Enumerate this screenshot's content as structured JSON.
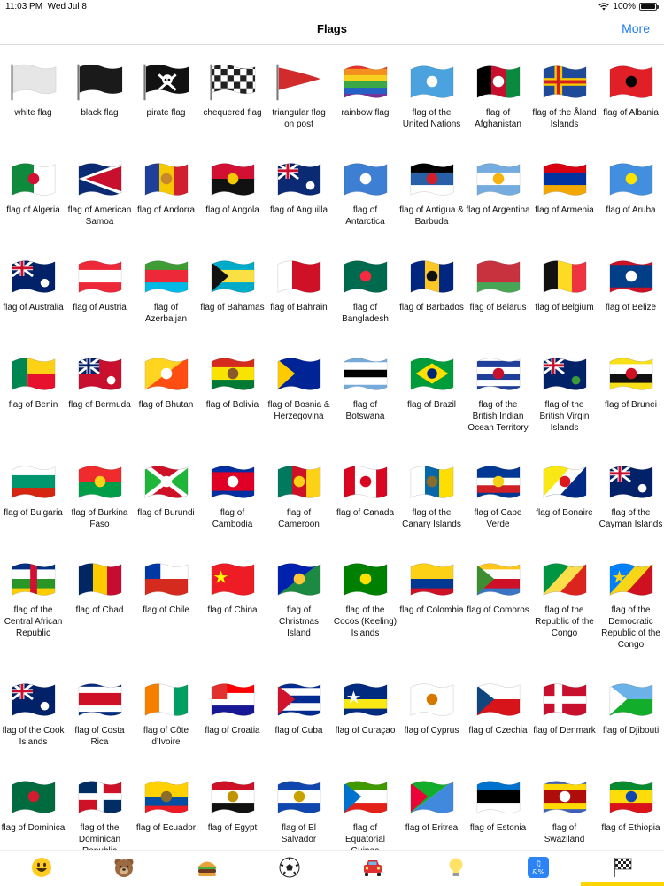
{
  "status": {
    "time": "11:03 PM",
    "date": "Wed Jul 8",
    "battery": "100%",
    "battery_level": 1.0,
    "wifi_icon": "wifi-icon"
  },
  "nav": {
    "title": "Flags",
    "more": "More"
  },
  "flags": [
    {
      "label": "white flag",
      "kind": "post-flag",
      "colors": [
        "#e6e6e6"
      ]
    },
    {
      "label": "black flag",
      "kind": "post-flag",
      "colors": [
        "#1a1a1a"
      ]
    },
    {
      "label": "pirate flag",
      "kind": "post-flag",
      "colors": [
        "#111111"
      ],
      "emblem": "skull"
    },
    {
      "label": "chequered flag",
      "kind": "post-flag",
      "colors": [
        "#222222"
      ],
      "emblem": "checker"
    },
    {
      "label": "triangular flag on post",
      "kind": "triangle",
      "colors": [
        "#d22b2b"
      ]
    },
    {
      "label": "rainbow flag",
      "kind": "h",
      "colors": [
        "#e8322c",
        "#f39020",
        "#f6d21f",
        "#3aa846",
        "#2460c6",
        "#7d2f90"
      ]
    },
    {
      "label": "flag of the United Nations",
      "kind": "solid",
      "colors": [
        "#4aa3df"
      ],
      "emblem": "circle",
      "emblem_color": "#ffffff"
    },
    {
      "label": "flag of Afghanistan",
      "kind": "v",
      "colors": [
        "#000000",
        "#c8102e",
        "#0a8a3f"
      ],
      "emblem": "circle",
      "emblem_color": "#ffffff"
    },
    {
      "label": "flag of the Åland Islands",
      "kind": "nordic",
      "colors": [
        "#1f4a9a",
        "#f5c800",
        "#d22020"
      ]
    },
    {
      "label": "flag of Albania",
      "kind": "solid",
      "colors": [
        "#e11f26"
      ],
      "emblem": "circle",
      "emblem_color": "#000000"
    },
    {
      "label": "flag of Algeria",
      "kind": "v",
      "colors": [
        "#0f8a3c",
        "#ffffff"
      ],
      "emblem": "circle",
      "emblem_color": "#d21034"
    },
    {
      "label": "flag of American Samoa",
      "kind": "triangle-left",
      "colors": [
        "#0b2a74",
        "#ffffff",
        "#c8102e"
      ]
    },
    {
      "label": "flag of Andorra",
      "kind": "v",
      "colors": [
        "#1f3f9a",
        "#f5c800",
        "#d11f2f"
      ],
      "emblem": "circle",
      "emblem_color": "#c7892a"
    },
    {
      "label": "flag of Angola",
      "kind": "h",
      "colors": [
        "#d21034",
        "#111111"
      ],
      "emblem": "circle",
      "emblem_color": "#f5c800"
    },
    {
      "label": "flag of Anguilla",
      "kind": "canton",
      "colors": [
        "#0b2a74",
        "#c8102e"
      ],
      "emblem": "circle",
      "emblem_color": "#ffffff"
    },
    {
      "label": "flag of Antarctica",
      "kind": "solid",
      "colors": [
        "#3d7fd3"
      ],
      "emblem": "circle",
      "emblem_color": "#ffffff"
    },
    {
      "label": "flag of Antigua & Barbuda",
      "kind": "h",
      "colors": [
        "#000000",
        "#2760a6",
        "#ffffff"
      ],
      "emblem": "circle",
      "emblem_color": "#d31f2a"
    },
    {
      "label": "flag of Argentina",
      "kind": "h",
      "colors": [
        "#74acdf",
        "#ffffff",
        "#74acdf"
      ],
      "emblem": "circle",
      "emblem_color": "#f6b40e"
    },
    {
      "label": "flag of Armenia",
      "kind": "h",
      "colors": [
        "#d90012",
        "#0033a0",
        "#f2a800"
      ]
    },
    {
      "label": "flag of Aruba",
      "kind": "solid",
      "colors": [
        "#418fde"
      ],
      "emblem": "circle",
      "emblem_color": "#f9e300"
    },
    {
      "label": "flag of Australia",
      "kind": "canton",
      "colors": [
        "#012169",
        "#c8102e"
      ],
      "emblem": "circle",
      "emblem_color": "#ffffff"
    },
    {
      "label": "flag of Austria",
      "kind": "h",
      "colors": [
        "#ed2939",
        "#ffffff",
        "#ed2939"
      ]
    },
    {
      "label": "flag of Azerbaijan",
      "kind": "h",
      "colors": [
        "#3f9c35",
        "#ed2939",
        "#00b9e4"
      ]
    },
    {
      "label": "flag of Bahamas",
      "kind": "h",
      "colors": [
        "#00abc9",
        "#fae042",
        "#00abc9"
      ],
      "emblem": "triangle",
      "emblem_color": "#111111"
    },
    {
      "label": "flag of Bahrain",
      "kind": "v",
      "colors": [
        "#ffffff",
        "#ce1126",
        "#ce1126"
      ]
    },
    {
      "label": "flag of Bangladesh",
      "kind": "solid",
      "colors": [
        "#006a4e"
      ],
      "emblem": "circle",
      "emblem_color": "#f42a41"
    },
    {
      "label": "flag of Barbados",
      "kind": "v",
      "colors": [
        "#00267f",
        "#ffc726",
        "#00267f"
      ],
      "emblem": "circle",
      "emblem_color": "#111111"
    },
    {
      "label": "flag of Belarus",
      "kind": "h",
      "colors": [
        "#c8313e",
        "#c8313e",
        "#4aa657"
      ]
    },
    {
      "label": "flag of Belgium",
      "kind": "v",
      "colors": [
        "#111111",
        "#fdda24",
        "#ef3340"
      ]
    },
    {
      "label": "flag of Belize",
      "kind": "h",
      "colors": [
        "#ce1126",
        "#003f87",
        "#003f87",
        "#003f87",
        "#ce1126"
      ],
      "emblem": "circle",
      "emblem_color": "#ffffff"
    },
    {
      "label": "flag of Benin",
      "kind": "split",
      "colors": [
        "#008751",
        "#fcd116",
        "#e8112d"
      ]
    },
    {
      "label": "flag of Bermuda",
      "kind": "canton",
      "colors": [
        "#c8102e",
        "#012169"
      ],
      "emblem": "circle",
      "emblem_color": "#ffffff"
    },
    {
      "label": "flag of Bhutan",
      "kind": "diag",
      "colors": [
        "#ffd520",
        "#ff4e12"
      ],
      "emblem": "circle",
      "emblem_color": "#ffffff"
    },
    {
      "label": "flag of Bolivia",
      "kind": "h",
      "colors": [
        "#d52b1e",
        "#f9e300",
        "#007934"
      ],
      "emblem": "circle",
      "emblem_color": "#8a5a2b"
    },
    {
      "label": "flag of Bosnia & Herzegovina",
      "kind": "solid",
      "colors": [
        "#002395"
      ],
      "emblem": "triangle",
      "emblem_color": "#fecb00"
    },
    {
      "label": "flag of Botswana",
      "kind": "h",
      "colors": [
        "#75aadb",
        "#ffffff",
        "#000000",
        "#ffffff",
        "#75aadb"
      ]
    },
    {
      "label": "flag of Brazil",
      "kind": "solid",
      "colors": [
        "#009c3b"
      ],
      "emblem": "diamond",
      "emblem_color": "#ffdf00"
    },
    {
      "label": "flag of the British Indian Ocean Territory",
      "kind": "h",
      "colors": [
        "#ffffff",
        "#1f3f9a",
        "#ffffff",
        "#1f3f9a",
        "#ffffff",
        "#1f3f9a"
      ],
      "emblem": "circle",
      "emblem_color": "#c8102e"
    },
    {
      "label": "flag of the British Virgin Islands",
      "kind": "canton",
      "colors": [
        "#012169",
        "#c8102e"
      ],
      "emblem": "circle",
      "emblem_color": "#3a9b3a"
    },
    {
      "label": "flag of Brunei",
      "kind": "h",
      "colors": [
        "#f7e017",
        "#ffffff",
        "#111111",
        "#f7e017"
      ],
      "emblem": "circle",
      "emblem_color": "#cf1126"
    },
    {
      "label": "flag of Bulgaria",
      "kind": "h",
      "colors": [
        "#ffffff",
        "#00966e",
        "#d62612"
      ]
    },
    {
      "label": "flag of Burkina Faso",
      "kind": "h",
      "colors": [
        "#ef2b2d",
        "#009e49"
      ],
      "emblem": "circle",
      "emblem_color": "#fcd116"
    },
    {
      "label": "flag of Burundi",
      "kind": "x",
      "colors": [
        "#ce1126",
        "#1eb53a",
        "#ffffff"
      ],
      "emblem": "circle",
      "emblem_color": "#ffffff"
    },
    {
      "label": "flag of Cambodia",
      "kind": "h",
      "colors": [
        "#032ea1",
        "#e00025",
        "#e00025",
        "#032ea1"
      ],
      "emblem": "circle",
      "emblem_color": "#ffffff"
    },
    {
      "label": "flag of Cameroon",
      "kind": "v",
      "colors": [
        "#007a5e",
        "#ce1126",
        "#fcd116"
      ],
      "emblem": "circle",
      "emblem_color": "#fcd116"
    },
    {
      "label": "flag of Canada",
      "kind": "v",
      "colors": [
        "#d80621",
        "#ffffff",
        "#ffffff",
        "#d80621"
      ],
      "emblem": "circle",
      "emblem_color": "#d80621"
    },
    {
      "label": "flag of the Canary Islands",
      "kind": "v",
      "colors": [
        "#ffffff",
        "#0768a9",
        "#fedd00"
      ],
      "emblem": "circle",
      "emblem_color": "#8a6d2b"
    },
    {
      "label": "flag of Cape Verde",
      "kind": "h",
      "colors": [
        "#003893",
        "#003893",
        "#ffffff",
        "#cf2027",
        "#003893"
      ],
      "emblem": "circle",
      "emblem_color": "#f7d116"
    },
    {
      "label": "flag of Bonaire",
      "kind": "diag",
      "colors": [
        "#f9e814",
        "#ffffff",
        "#012a87"
      ],
      "emblem": "circle",
      "emblem_color": "#dc171d"
    },
    {
      "label": "flag of the Cayman Islands",
      "kind": "canton",
      "colors": [
        "#012169",
        "#c8102e"
      ],
      "emblem": "circle",
      "emblem_color": "#ffffff"
    },
    {
      "label": "flag of the Central African Republic",
      "kind": "h",
      "colors": [
        "#003082",
        "#ffffff",
        "#289728",
        "#ffce00"
      ],
      "emblem": "vbar",
      "emblem_color": "#d21034"
    },
    {
      "label": "flag of Chad",
      "kind": "v",
      "colors": [
        "#002664",
        "#fecb00",
        "#c60c30"
      ]
    },
    {
      "label": "flag of Chile",
      "kind": "h",
      "colors": [
        "#ffffff",
        "#d52b1e"
      ],
      "emblem": "square",
      "emblem_color": "#0039a6"
    },
    {
      "label": "flag of China",
      "kind": "solid",
      "colors": [
        "#ee1c25"
      ],
      "emblem": "star",
      "emblem_color": "#ffff00"
    },
    {
      "label": "flag of Christmas Island",
      "kind": "diag",
      "colors": [
        "#0021ad",
        "#1c8a42"
      ],
      "emblem": "circle",
      "emblem_color": "#ffc639"
    },
    {
      "label": "flag of the Cocos (Keeling) Islands",
      "kind": "solid",
      "colors": [
        "#008000"
      ],
      "emblem": "circle",
      "emblem_color": "#ffe000"
    },
    {
      "label": "flag of Colombia",
      "kind": "h",
      "colors": [
        "#fcd116",
        "#fcd116",
        "#003893",
        "#ce1126"
      ]
    },
    {
      "label": "flag of Comoros",
      "kind": "h",
      "colors": [
        "#ffc61e",
        "#ffffff",
        "#ce1126",
        "#3a75c4"
      ],
      "emblem": "triangle",
      "emblem_color": "#3d8e33"
    },
    {
      "label": "flag of the Republic of the Congo",
      "kind": "diag",
      "colors": [
        "#009543",
        "#fbde4a",
        "#dc241f"
      ]
    },
    {
      "label": "flag of the Democratic Republic of the Congo",
      "kind": "diag",
      "colors": [
        "#007fff",
        "#f7d618",
        "#ce1021"
      ],
      "emblem": "star",
      "emblem_color": "#f7d618"
    },
    {
      "label": "flag of the Cook Islands",
      "kind": "canton",
      "colors": [
        "#012169",
        "#c8102e"
      ],
      "emblem": "circle",
      "emblem_color": "#ffffff"
    },
    {
      "label": "flag of Costa Rica",
      "kind": "h",
      "colors": [
        "#002b7f",
        "#ffffff",
        "#ce1126",
        "#ce1126",
        "#ffffff",
        "#002b7f"
      ]
    },
    {
      "label": "flag of Côte d’Ivoire",
      "kind": "v",
      "colors": [
        "#f77f00",
        "#ffffff",
        "#009e60"
      ]
    },
    {
      "label": "flag of Croatia",
      "kind": "h",
      "colors": [
        "#ff0000",
        "#ffffff",
        "#171796"
      ],
      "emblem": "square",
      "emblem_color": "#e03030"
    },
    {
      "label": "flag of Cuba",
      "kind": "h",
      "colors": [
        "#002a8f",
        "#ffffff",
        "#002a8f",
        "#ffffff",
        "#002a8f"
      ],
      "emblem": "triangle",
      "emblem_color": "#cf142b"
    },
    {
      "label": "flag of Curaçao",
      "kind": "h",
      "colors": [
        "#002b7f",
        "#002b7f",
        "#f9e814",
        "#002b7f"
      ],
      "emblem": "star",
      "emblem_color": "#ffffff"
    },
    {
      "label": "flag of Cyprus",
      "kind": "solid",
      "colors": [
        "#ffffff"
      ],
      "emblem": "circle",
      "emblem_color": "#d57800"
    },
    {
      "label": "flag of Czechia",
      "kind": "h",
      "colors": [
        "#ffffff",
        "#d7141a"
      ],
      "emblem": "triangle",
      "emblem_color": "#11457e"
    },
    {
      "label": "flag of Denmark",
      "kind": "nordic",
      "colors": [
        "#c8102e",
        "#ffffff",
        "#ffffff"
      ]
    },
    {
      "label": "flag of Djibouti",
      "kind": "h",
      "colors": [
        "#6ab2e7",
        "#12ad2b"
      ],
      "emblem": "triangle",
      "emblem_color": "#ffffff"
    },
    {
      "label": "flag of Dominica",
      "kind": "solid",
      "colors": [
        "#006b3f"
      ],
      "emblem": "circle",
      "emblem_color": "#d41c30"
    },
    {
      "label": "flag of the Dominican Republic",
      "kind": "quad",
      "colors": [
        "#002d62",
        "#ce1126",
        "#ce1126",
        "#002d62"
      ],
      "emblem": "cross",
      "emblem_color": "#ffffff"
    },
    {
      "label": "flag of Ecuador",
      "kind": "h",
      "colors": [
        "#ffd100",
        "#ffd100",
        "#034ea2",
        "#ed1c24"
      ],
      "emblem": "circle",
      "emblem_color": "#8a6d2b"
    },
    {
      "label": "flag of Egypt",
      "kind": "h",
      "colors": [
        "#ce1126",
        "#ffffff",
        "#111111"
      ],
      "emblem": "circle",
      "emblem_color": "#c09300"
    },
    {
      "label": "flag of El Salvador",
      "kind": "h",
      "colors": [
        "#0f47af",
        "#ffffff",
        "#0f47af"
      ],
      "emblem": "circle",
      "emblem_color": "#c8a200"
    },
    {
      "label": "flag of Equatorial Guinea",
      "kind": "h",
      "colors": [
        "#3e9a00",
        "#ffffff",
        "#e32118"
      ],
      "emblem": "triangle",
      "emblem_color": "#0073ce"
    },
    {
      "label": "flag of Eritrea",
      "kind": "diag",
      "colors": [
        "#12ad2b",
        "#4189dd"
      ],
      "emblem": "triangle",
      "emblem_color": "#ea0437"
    },
    {
      "label": "flag of Estonia",
      "kind": "h",
      "colors": [
        "#0072ce",
        "#000000",
        "#ffffff"
      ]
    },
    {
      "label": "flag of Swaziland",
      "kind": "h",
      "colors": [
        "#3e5eb9",
        "#ffd900",
        "#b10c0c",
        "#b10c0c",
        "#ffd900",
        "#3e5eb9"
      ],
      "emblem": "circle",
      "emblem_color": "#ffffff"
    },
    {
      "label": "flag of Ethiopia",
      "kind": "h",
      "colors": [
        "#078930",
        "#fcdd09",
        "#da121a"
      ],
      "emblem": "circle",
      "emblem_color": "#0f47af"
    }
  ],
  "tabs": [
    {
      "name": "smileys",
      "icon": "smiley-face-icon"
    },
    {
      "name": "animals",
      "icon": "bear-face-icon"
    },
    {
      "name": "food",
      "icon": "hamburger-icon"
    },
    {
      "name": "activity",
      "icon": "soccer-ball-icon"
    },
    {
      "name": "travel",
      "icon": "red-car-icon"
    },
    {
      "name": "objects",
      "icon": "light-bulb-icon"
    },
    {
      "name": "symbols",
      "icon": "symbols-icon"
    },
    {
      "name": "flags",
      "icon": "chequered-flag-icon"
    }
  ]
}
